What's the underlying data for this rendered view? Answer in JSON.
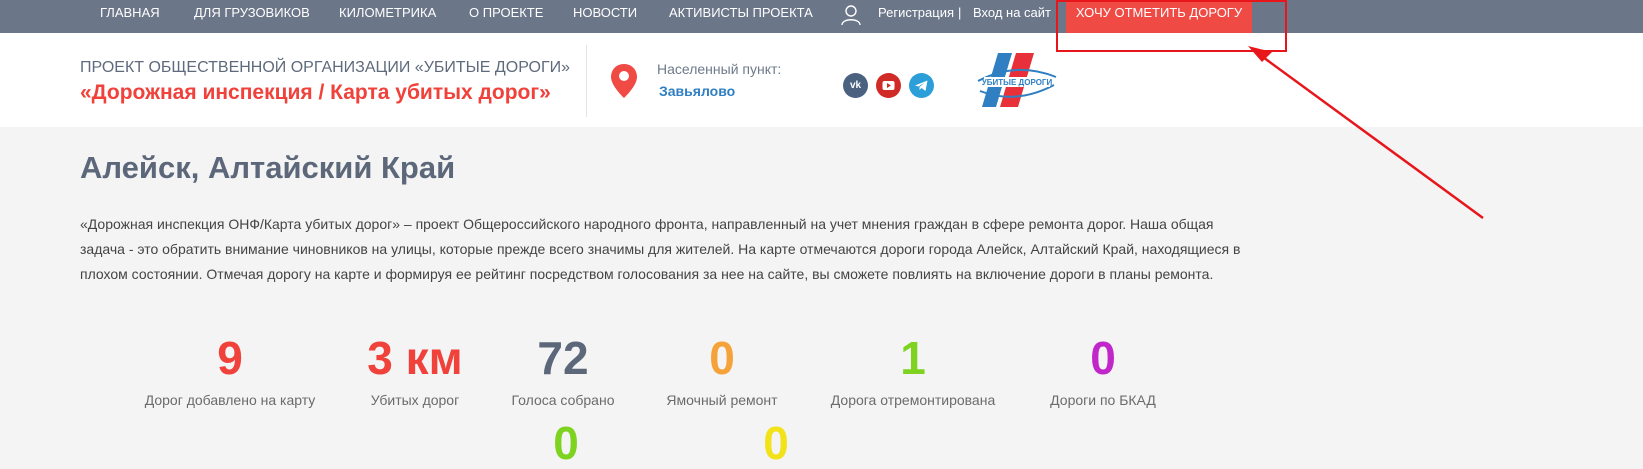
{
  "nav": {
    "items": [
      "ГЛАВНАЯ",
      "ДЛЯ ГРУЗОВИКОВ",
      "КИЛОМЕТРИКА",
      "О ПРОЕКТЕ",
      "НОВОСТИ",
      "АКТИВИСТЫ ПРОЕКТА"
    ],
    "register": "Регистрация",
    "separator": "|",
    "login": "Вход на сайт",
    "cta": "ХОЧУ ОТМЕТИТЬ ДОРОГУ"
  },
  "header": {
    "org": "ПРОЕКТ ОБЩЕСТВЕННОЙ ОРГАНИЗАЦИИ «УБИТЫЕ ДОРОГИ»",
    "title": "«Дорожная инспекция / Карта убитых дорог»",
    "location_label": "Населенный пункт:",
    "location_value": "Завьялово",
    "social": [
      "vk",
      "youtube",
      "telegram"
    ],
    "logo_text": "УБИТЫЕ ДОРОГИ"
  },
  "main": {
    "title": "Алейск, Алтайский Край",
    "description": "«Дорожная инспекция ОНФ/Карта убитых дорог» – проект Общероссийского народного фронта, направленный на учет мнения граждан в сфере ремонта дорог. Наша общая задача - это обратить внимание чиновников на улицы, которые прежде всего значимы для жителей. На карте отмечаются дороги города Алейск, Алтайский Край, находящиеся в плохом состоянии. Отмечая дорогу на карте и формируя ее рейтинг посредством голосования за нее на сайте, вы сможете повлиять на включение дороги в планы ремонта."
  },
  "stats": [
    {
      "value": "9",
      "label": "Дорог добавлено на карту",
      "color": "#f0413a"
    },
    {
      "value": "3 км",
      "label": "Убитых дорог",
      "color": "#f0413a"
    },
    {
      "value": "72",
      "label": "Голоса собрано",
      "color": "#5c6779"
    },
    {
      "value": "0",
      "label": "Ямочный ремонт",
      "color": "#f5a23a"
    },
    {
      "value": "1",
      "label": "Дорога отремонтирована",
      "color": "#7ed321"
    },
    {
      "value": "0",
      "label": "Дороги по БКАД",
      "color": "#c026c9"
    },
    {
      "value": "0",
      "label": "",
      "color": "#7ed321"
    },
    {
      "value": "0",
      "label": "",
      "color": "#f2e21a"
    }
  ],
  "colors": {
    "nav_bg": "#6b7689",
    "accent": "#f04a45",
    "annotation": "#e8151b"
  }
}
